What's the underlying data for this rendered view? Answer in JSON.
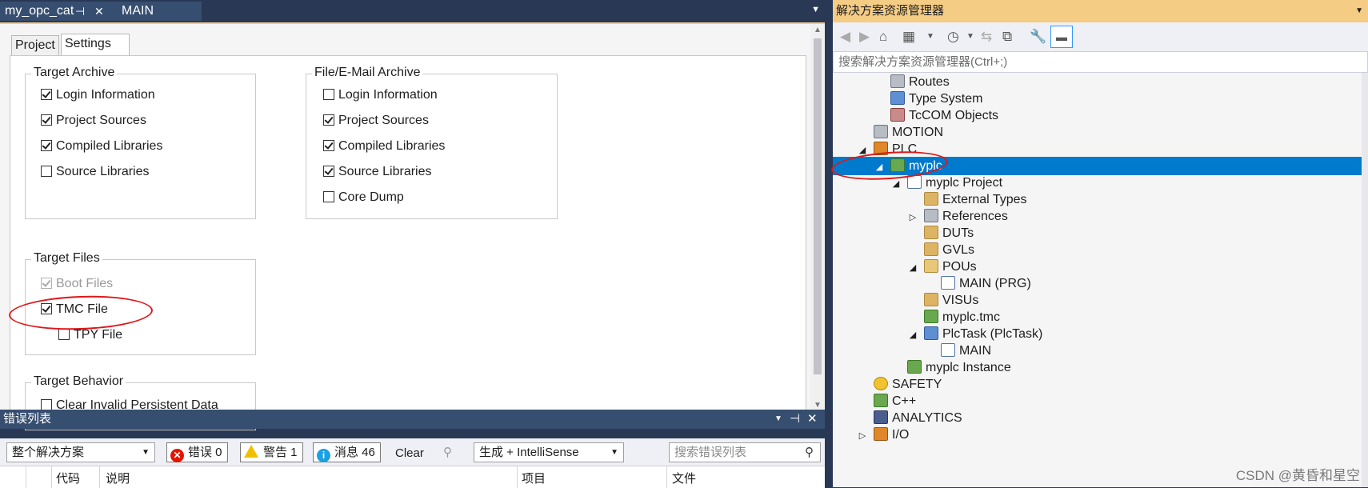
{
  "doc_tabs": {
    "active": "my_opc_cat",
    "second": "MAIN",
    "pin": "⊣",
    "close": "✕",
    "overflow": "▼"
  },
  "settings": {
    "tabs": [
      "Project",
      "Settings"
    ],
    "target_archive": {
      "title": "Target Archive",
      "items": [
        {
          "label": "Login Information",
          "checked": true
        },
        {
          "label": "Project Sources",
          "checked": true
        },
        {
          "label": "Compiled Libraries",
          "checked": true
        },
        {
          "label": "Source Libraries",
          "checked": false
        }
      ]
    },
    "file_archive": {
      "title": "File/E-Mail Archive",
      "items": [
        {
          "label": "Login Information",
          "checked": false
        },
        {
          "label": "Project Sources",
          "checked": true
        },
        {
          "label": "Compiled Libraries",
          "checked": true
        },
        {
          "label": "Source Libraries",
          "checked": true
        },
        {
          "label": "Core Dump",
          "checked": false
        }
      ]
    },
    "target_files": {
      "title": "Target Files",
      "items": [
        {
          "label": "Boot Files",
          "checked": true,
          "disabled": true
        },
        {
          "label": "TMC File",
          "checked": true
        },
        {
          "label": "TPY File",
          "checked": false
        }
      ]
    },
    "target_behavior": {
      "title": "Target Behavior",
      "items": [
        {
          "label": "Clear Invalid Persistent Data",
          "checked": false
        }
      ]
    }
  },
  "error_list": {
    "title": "错误列表",
    "scope": "整个解决方案",
    "errors": "错误 0",
    "warnings": "警告 1",
    "messages": "消息 46",
    "clear": "Clear",
    "build": "生成 + IntelliSense",
    "search_placeholder": "搜索错误列表",
    "columns": [
      "代码",
      "说明",
      "项目",
      "文件"
    ],
    "header_icons": [
      "▼",
      "⊣",
      "✕"
    ]
  },
  "solution_explorer": {
    "title": "解决方案资源管理器",
    "search_placeholder": "搜索解决方案资源管理器(Ctrl+;)",
    "tree": [
      {
        "label": "Routes",
        "icon": "routes-icon",
        "level": 3,
        "exp": ""
      },
      {
        "label": "Type System",
        "icon": "type-system-icon",
        "level": 3,
        "exp": ""
      },
      {
        "label": "TcCOM Objects",
        "icon": "tccom-objects-icon",
        "level": 3,
        "exp": ""
      },
      {
        "label": "MOTION",
        "icon": "motion-icon",
        "level": 2,
        "exp": ""
      },
      {
        "label": "PLC",
        "icon": "plc-icon",
        "level": 2,
        "exp": "◢"
      },
      {
        "label": "myplc",
        "icon": "plc-project-icon",
        "level": 3,
        "exp": "◢",
        "selected": true
      },
      {
        "label": "myplc Project",
        "icon": "project-icon",
        "level": 4,
        "exp": "◢"
      },
      {
        "label": "External Types",
        "icon": "folder-icon",
        "level": 5,
        "exp": ""
      },
      {
        "label": "References",
        "icon": "references-icon",
        "level": 5,
        "exp": "▷"
      },
      {
        "label": "DUTs",
        "icon": "folder-icon",
        "level": 5,
        "exp": ""
      },
      {
        "label": "GVLs",
        "icon": "folder-icon",
        "level": 5,
        "exp": ""
      },
      {
        "label": "POUs",
        "icon": "folder-open-icon",
        "level": 5,
        "exp": "◢"
      },
      {
        "label": "MAIN (PRG)",
        "icon": "program-icon",
        "level": 6,
        "exp": ""
      },
      {
        "label": "VISUs",
        "icon": "folder-icon",
        "level": 5,
        "exp": ""
      },
      {
        "label": "myplc.tmc",
        "icon": "tmc-file-icon",
        "level": 5,
        "exp": ""
      },
      {
        "label": "PlcTask (PlcTask)",
        "icon": "task-icon",
        "level": 5,
        "exp": "◢"
      },
      {
        "label": "MAIN",
        "icon": "task-call-icon",
        "level": 6,
        "exp": ""
      },
      {
        "label": "myplc Instance",
        "icon": "instance-icon",
        "level": 4,
        "exp": ""
      },
      {
        "label": "SAFETY",
        "icon": "safety-icon",
        "level": 2,
        "exp": ""
      },
      {
        "label": "C++",
        "icon": "cpp-icon",
        "level": 2,
        "exp": ""
      },
      {
        "label": "ANALYTICS",
        "icon": "analytics-icon",
        "level": 2,
        "exp": ""
      },
      {
        "label": "I/O",
        "icon": "io-icon",
        "level": 2,
        "exp": "▷"
      }
    ]
  },
  "watermark": "CSDN @黄昏和星空",
  "colors": {
    "accent": "#007acc",
    "header_gold": "#f5cc84",
    "dark_blue": "#293955",
    "annotation_red": "#e0171a"
  }
}
